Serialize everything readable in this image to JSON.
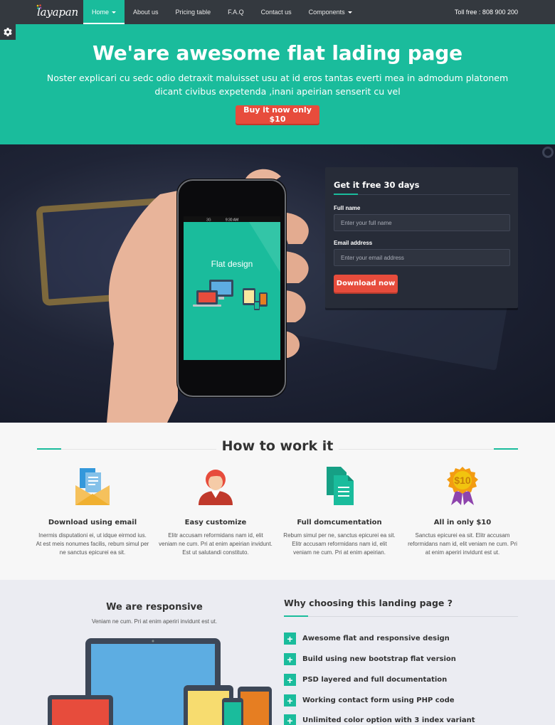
{
  "nav": {
    "logo": "layapan",
    "items": [
      {
        "label": "Home",
        "active": true,
        "dropdown": true
      },
      {
        "label": "About us",
        "active": false,
        "dropdown": false
      },
      {
        "label": "Pricing table",
        "active": false,
        "dropdown": false
      },
      {
        "label": "F.A.Q",
        "active": false,
        "dropdown": false
      },
      {
        "label": "Contact us",
        "active": false,
        "dropdown": false
      },
      {
        "label": "Components",
        "active": false,
        "dropdown": true
      }
    ],
    "toll_free": "Toll free : 808 900 200"
  },
  "hero": {
    "title": "We'are awesome flat lading page",
    "subtitle": "Noster explicari cu sedc odio detraxit maluisset usu at id eros tantas everti mea in admodum platonem dicant civibus expetenda ,inani apeirian senserit cu vel",
    "button": "Buy it now only $10"
  },
  "phone": {
    "status_signal": "3G",
    "status_time": "9:30 AM",
    "screen_text": "Flat design"
  },
  "signup": {
    "title": "Get it free 30 days",
    "full_name_label": "Full name",
    "full_name_placeholder": "Enter your full name",
    "email_label": "Email address",
    "email_placeholder": "Enter your email address",
    "button": "Download now"
  },
  "how": {
    "title": "How to work it",
    "features": [
      {
        "icon": "envelope-documents-icon",
        "title": "Download using email",
        "text": "Inermis disputationi ei, ut idque eirmod ius. At est meis nonumes facilis, rebum simul per ne sanctus epicurei ea sit."
      },
      {
        "icon": "user-avatar-icon",
        "title": "Easy customize",
        "text": "Elitr accusam reformidans nam id, elit veniam ne cum. Pri at enim apeirian invidunt. Est ut salutandi constituto."
      },
      {
        "icon": "documents-icon",
        "title": "Full domcumentation",
        "text": "Rebum simul per ne, sanctus epicurei ea sit. Elitr accusam reformidans nam id, elit veniam ne cum. Pri at enim apeirian."
      },
      {
        "icon": "price-badge-icon",
        "badge_text": "$10",
        "title": "All in only $10",
        "text": "Sanctus epicurei ea sit. Elitr accusam reformidans nam id, elit veniam ne cum. Pri at enim aperiri invidunt est ut."
      }
    ]
  },
  "responsive": {
    "title": "We are responsive",
    "subtitle": "Veniam ne cum. Pri at enim aperiri invidunt est ut."
  },
  "why": {
    "title": "Why choosing this landing page ?",
    "items": [
      "Awesome flat and responsive design",
      "Build using new bootstrap flat version",
      "PSD layered and full documentation",
      "Working contact form using PHP code",
      "Unlimited color option with 3 index variant"
    ]
  },
  "colors": {
    "accent": "#1abc9c",
    "button_red": "#e74c3c",
    "nav_bg": "#34393f"
  }
}
